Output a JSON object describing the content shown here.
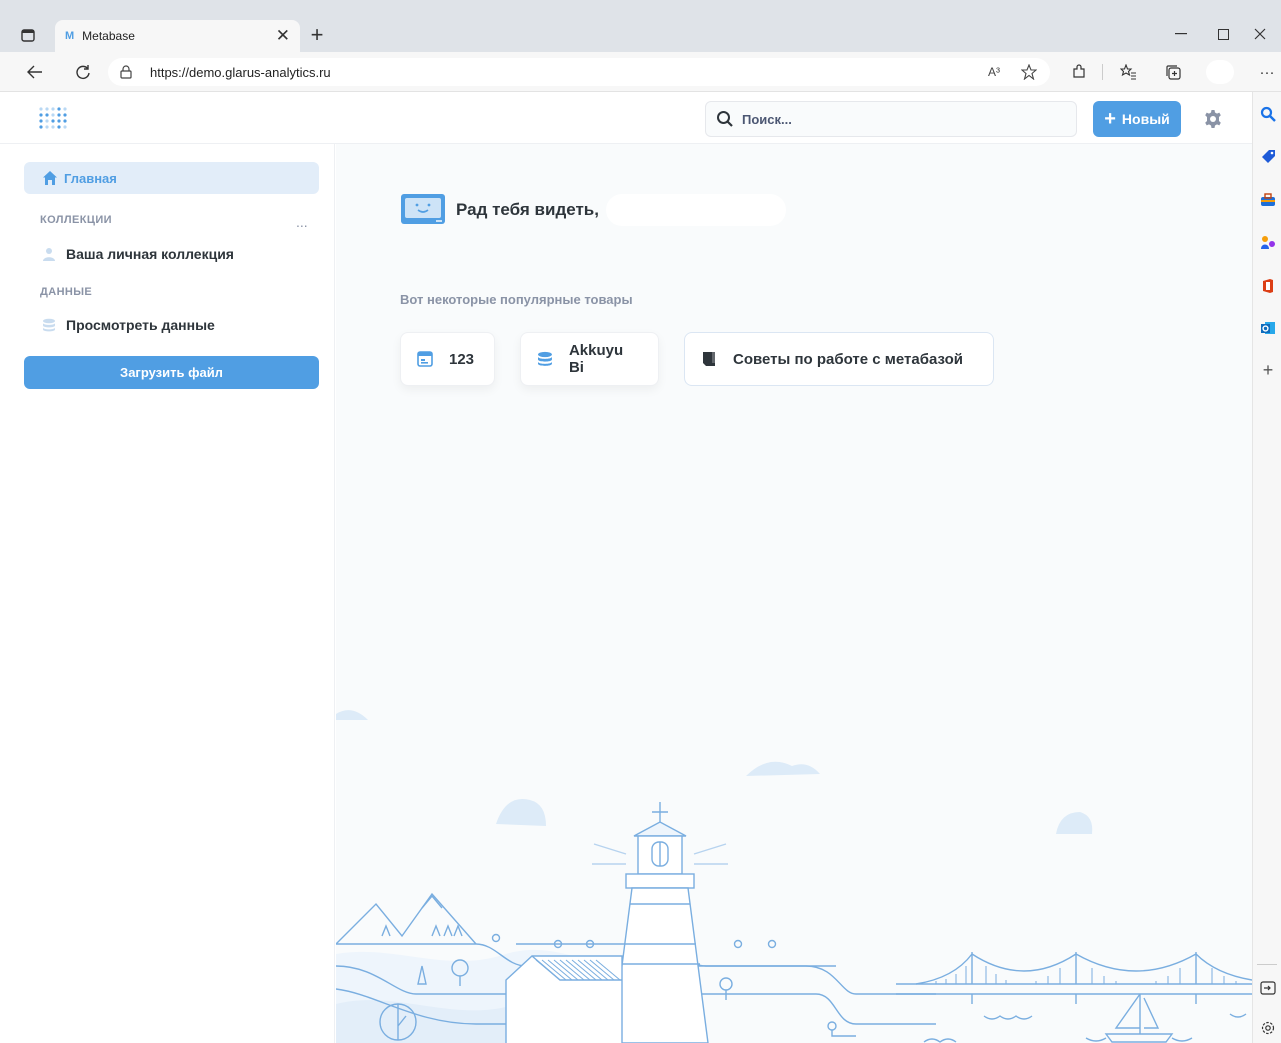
{
  "browser": {
    "tab_title": "Metabase",
    "tab_favicon": "M",
    "url": "https://demo.glarus-analytics.ru",
    "read_aloud": "A³",
    "new_tab_symbol": "+",
    "close_symbol": "✕",
    "more_symbol": "···"
  },
  "app": {
    "search_placeholder": "Поиск...",
    "new_button_label": "Новый",
    "accent_color": "#509ee3"
  },
  "sidebar": {
    "home_label": "Главная",
    "collections_heading": "КОЛЛЕКЦИИ",
    "collections_more": "...",
    "personal_collection": "Ваша личная коллекция",
    "data_heading": "ДАННЫЕ",
    "browse_data": "Просмотреть данные",
    "upload_button": "Загрузить файл"
  },
  "main": {
    "greeting": "Рад тебя видеть,",
    "popular_heading": "Вот некоторые популярные товары",
    "cards": [
      {
        "label": "123",
        "icon": "dashboard-icon"
      },
      {
        "label": "Akkuyu Bi",
        "icon": "database-icon"
      },
      {
        "label": "Советы по работе с метабазой",
        "icon": "book-icon"
      }
    ]
  }
}
